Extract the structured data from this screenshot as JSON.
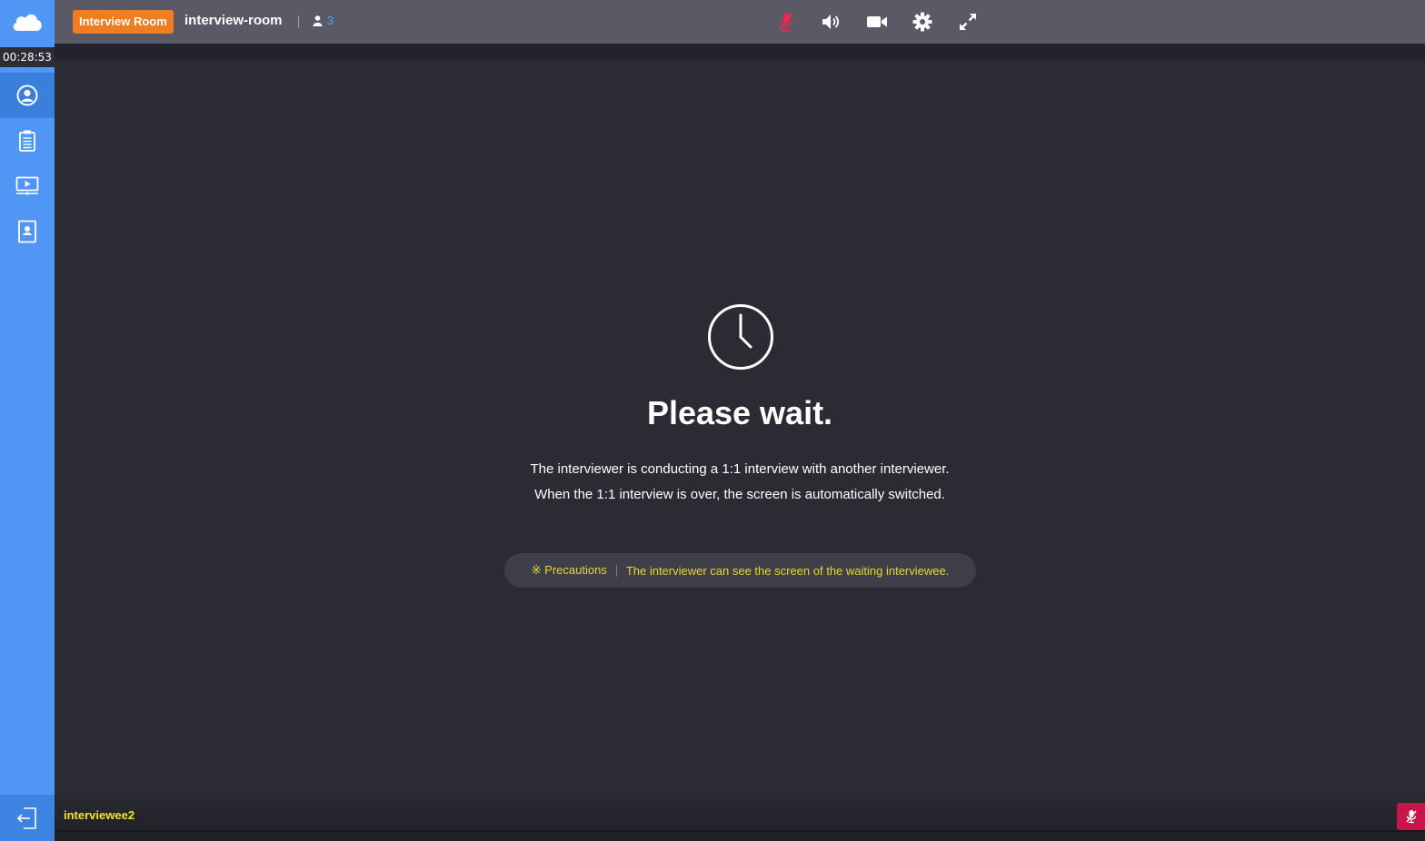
{
  "header": {
    "room_badge": "Interview Room",
    "room_name": "interview-room",
    "participant_count": "3",
    "icons": [
      "mic-muted-icon",
      "speaker-icon",
      "camera-icon",
      "settings-gear-icon",
      "fullscreen-icon"
    ]
  },
  "sidebar": {
    "timer": "00:28:53",
    "items": [
      {
        "icon": "user-profile-icon",
        "active": true
      },
      {
        "icon": "clipboard-icon",
        "active": false
      },
      {
        "icon": "screen-share-icon",
        "active": false
      },
      {
        "icon": "contact-card-icon",
        "active": false
      }
    ],
    "exit_icon": "exit-icon"
  },
  "main": {
    "title": "Please wait.",
    "line1": "The interviewer is conducting a 1:1 interview with another interviewer.",
    "line2": "When the 1:1 interview is over, the screen is automatically switched.",
    "notice_label": "※ Precautions",
    "notice_text": "The interviewer can see the screen of the waiting interviewee."
  },
  "footer": {
    "participant_name": "interviewee2"
  },
  "colors": {
    "sidebar": "#4f96f5",
    "topbar": "#595a66",
    "background": "#2b2c33",
    "badge": "#ef7d22",
    "notice_text": "#e8d634",
    "name": "#f2e526",
    "muted": "#c8144a"
  }
}
